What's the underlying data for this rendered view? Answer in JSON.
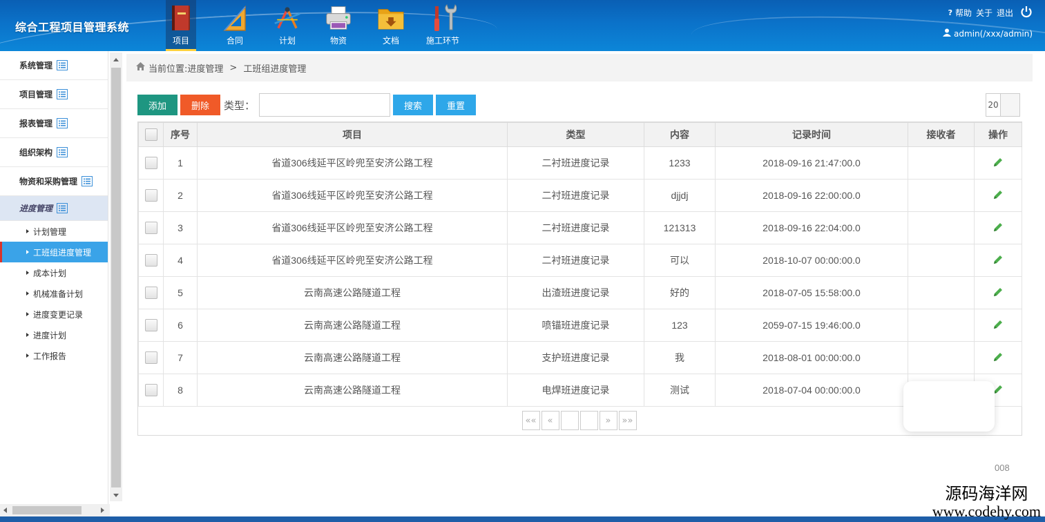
{
  "app": {
    "title": "综合工程项目管理系统"
  },
  "nav": [
    {
      "label": "项目",
      "icon": "book-icon",
      "active": true
    },
    {
      "label": "合同",
      "icon": "ruler-icon",
      "active": false
    },
    {
      "label": "计划",
      "icon": "compass-icon",
      "active": false
    },
    {
      "label": "物资",
      "icon": "printer-icon",
      "active": false
    },
    {
      "label": "文档",
      "icon": "folder-icon",
      "active": false
    },
    {
      "label": "施工环节",
      "icon": "tools-icon",
      "active": false
    }
  ],
  "header": {
    "help": "帮助",
    "about": "关于",
    "logout": "退出",
    "user": "admin(/xxx/admin)"
  },
  "sidebar": {
    "groups": [
      {
        "label": "系统管理"
      },
      {
        "label": "项目管理"
      },
      {
        "label": "报表管理"
      },
      {
        "label": "组织架构"
      },
      {
        "label": "物资和采购管理"
      },
      {
        "label": "进度管理"
      }
    ],
    "subitems": [
      {
        "label": "计划管理"
      },
      {
        "label": "工班组进度管理"
      },
      {
        "label": "成本计划"
      },
      {
        "label": "机械准备计划"
      },
      {
        "label": "进度变更记录"
      },
      {
        "label": "进度计划"
      },
      {
        "label": "工作报告"
      }
    ]
  },
  "breadcrumb": {
    "prefix": "当前位置:",
    "parent": "进度管理",
    "sep": ">",
    "current": "工班组进度管理"
  },
  "toolbar": {
    "add_label": "添加",
    "delete_label": "删除",
    "type_label": "类型：",
    "type_value": "",
    "search_label": "搜索",
    "reset_label": "重置",
    "page_size": "20"
  },
  "table": {
    "columns": [
      "序号",
      "项目",
      "类型",
      "内容",
      "记录时间",
      "接收者",
      "操作"
    ],
    "rows": [
      {
        "no": "1",
        "project": "省道306线延平区岭兜至安济公路工程",
        "type": "二衬班进度记录",
        "content": "1233",
        "time": "2018-09-16 21:47:00.0",
        "receiver": ""
      },
      {
        "no": "2",
        "project": "省道306线延平区岭兜至安济公路工程",
        "type": "二衬班进度记录",
        "content": "djjdj",
        "time": "2018-09-16 22:00:00.0",
        "receiver": ""
      },
      {
        "no": "3",
        "project": "省道306线延平区岭兜至安济公路工程",
        "type": "二衬班进度记录",
        "content": "121313",
        "time": "2018-09-16 22:04:00.0",
        "receiver": ""
      },
      {
        "no": "4",
        "project": "省道306线延平区岭兜至安济公路工程",
        "type": "二衬班进度记录",
        "content": "可以",
        "time": "2018-10-07 00:00:00.0",
        "receiver": ""
      },
      {
        "no": "5",
        "project": "云南高速公路隧道工程",
        "type": "出渣班进度记录",
        "content": "好的",
        "time": "2018-07-05 15:58:00.0",
        "receiver": ""
      },
      {
        "no": "6",
        "project": "云南高速公路隧道工程",
        "type": "喷锚班进度记录",
        "content": "123",
        "time": "2059-07-15 19:46:00.0",
        "receiver": ""
      },
      {
        "no": "7",
        "project": "云南高速公路隧道工程",
        "type": "支护班进度记录",
        "content": "我",
        "time": "2018-08-01 00:00:00.0",
        "receiver": ""
      },
      {
        "no": "8",
        "project": "云南高速公路隧道工程",
        "type": "电焊班进度记录",
        "content": "测试",
        "time": "2018-07-04 00:00:00.0",
        "receiver": ""
      }
    ]
  },
  "pager": {
    "first": "««",
    "prev": "«",
    "next": "»",
    "last": "»»",
    "page": "",
    "pages": ""
  },
  "footer": {
    "total": "008"
  },
  "watermark": {
    "line1": "源码海洋网",
    "line2": "www.codehy.com"
  },
  "colors": {
    "header": "#0b72c9",
    "add": "#1e9681",
    "delete": "#f05a28",
    "search": "#2ea7e9",
    "active_sub": "#3aa3e8"
  }
}
